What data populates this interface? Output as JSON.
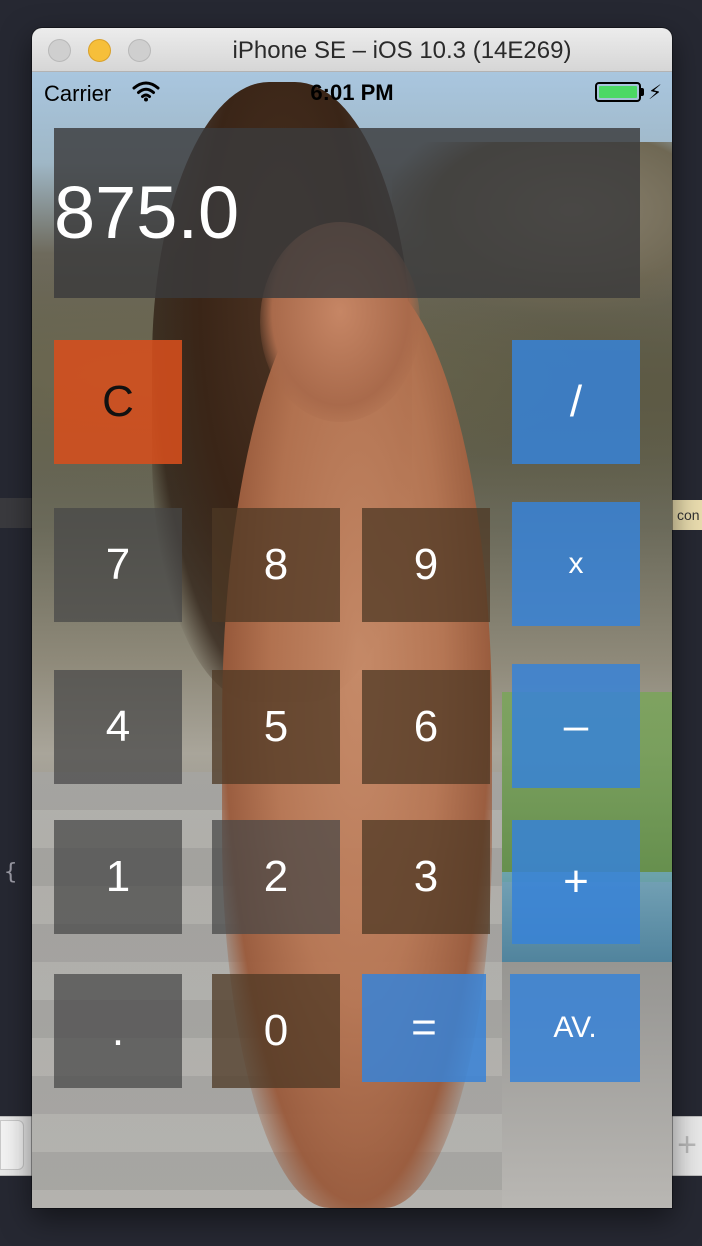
{
  "window": {
    "title": "iPhone SE – iOS 10.3 (14E269)"
  },
  "side": {
    "right_snippet": "con",
    "left_brace": "{",
    "bottom_plus": "+"
  },
  "statusbar": {
    "carrier": "Carrier",
    "time": "6:01 PM",
    "battery_level": 1.0
  },
  "display": {
    "value": "875.0"
  },
  "keys": {
    "clear": "C",
    "divide": "/",
    "seven": "7",
    "eight": "8",
    "nine": "9",
    "multiply": "x",
    "four": "4",
    "five": "5",
    "six": "6",
    "subtract": "–",
    "one": "1",
    "two": "2",
    "three": "3",
    "add": "+",
    "decimal": ".",
    "zero": "0",
    "equals": "=",
    "average": "AV."
  },
  "colors": {
    "clear_key": "#d64e1c",
    "operator_key": "#3782d7",
    "battery": "#4cd964",
    "minimize_button": "#f6bf3a"
  }
}
